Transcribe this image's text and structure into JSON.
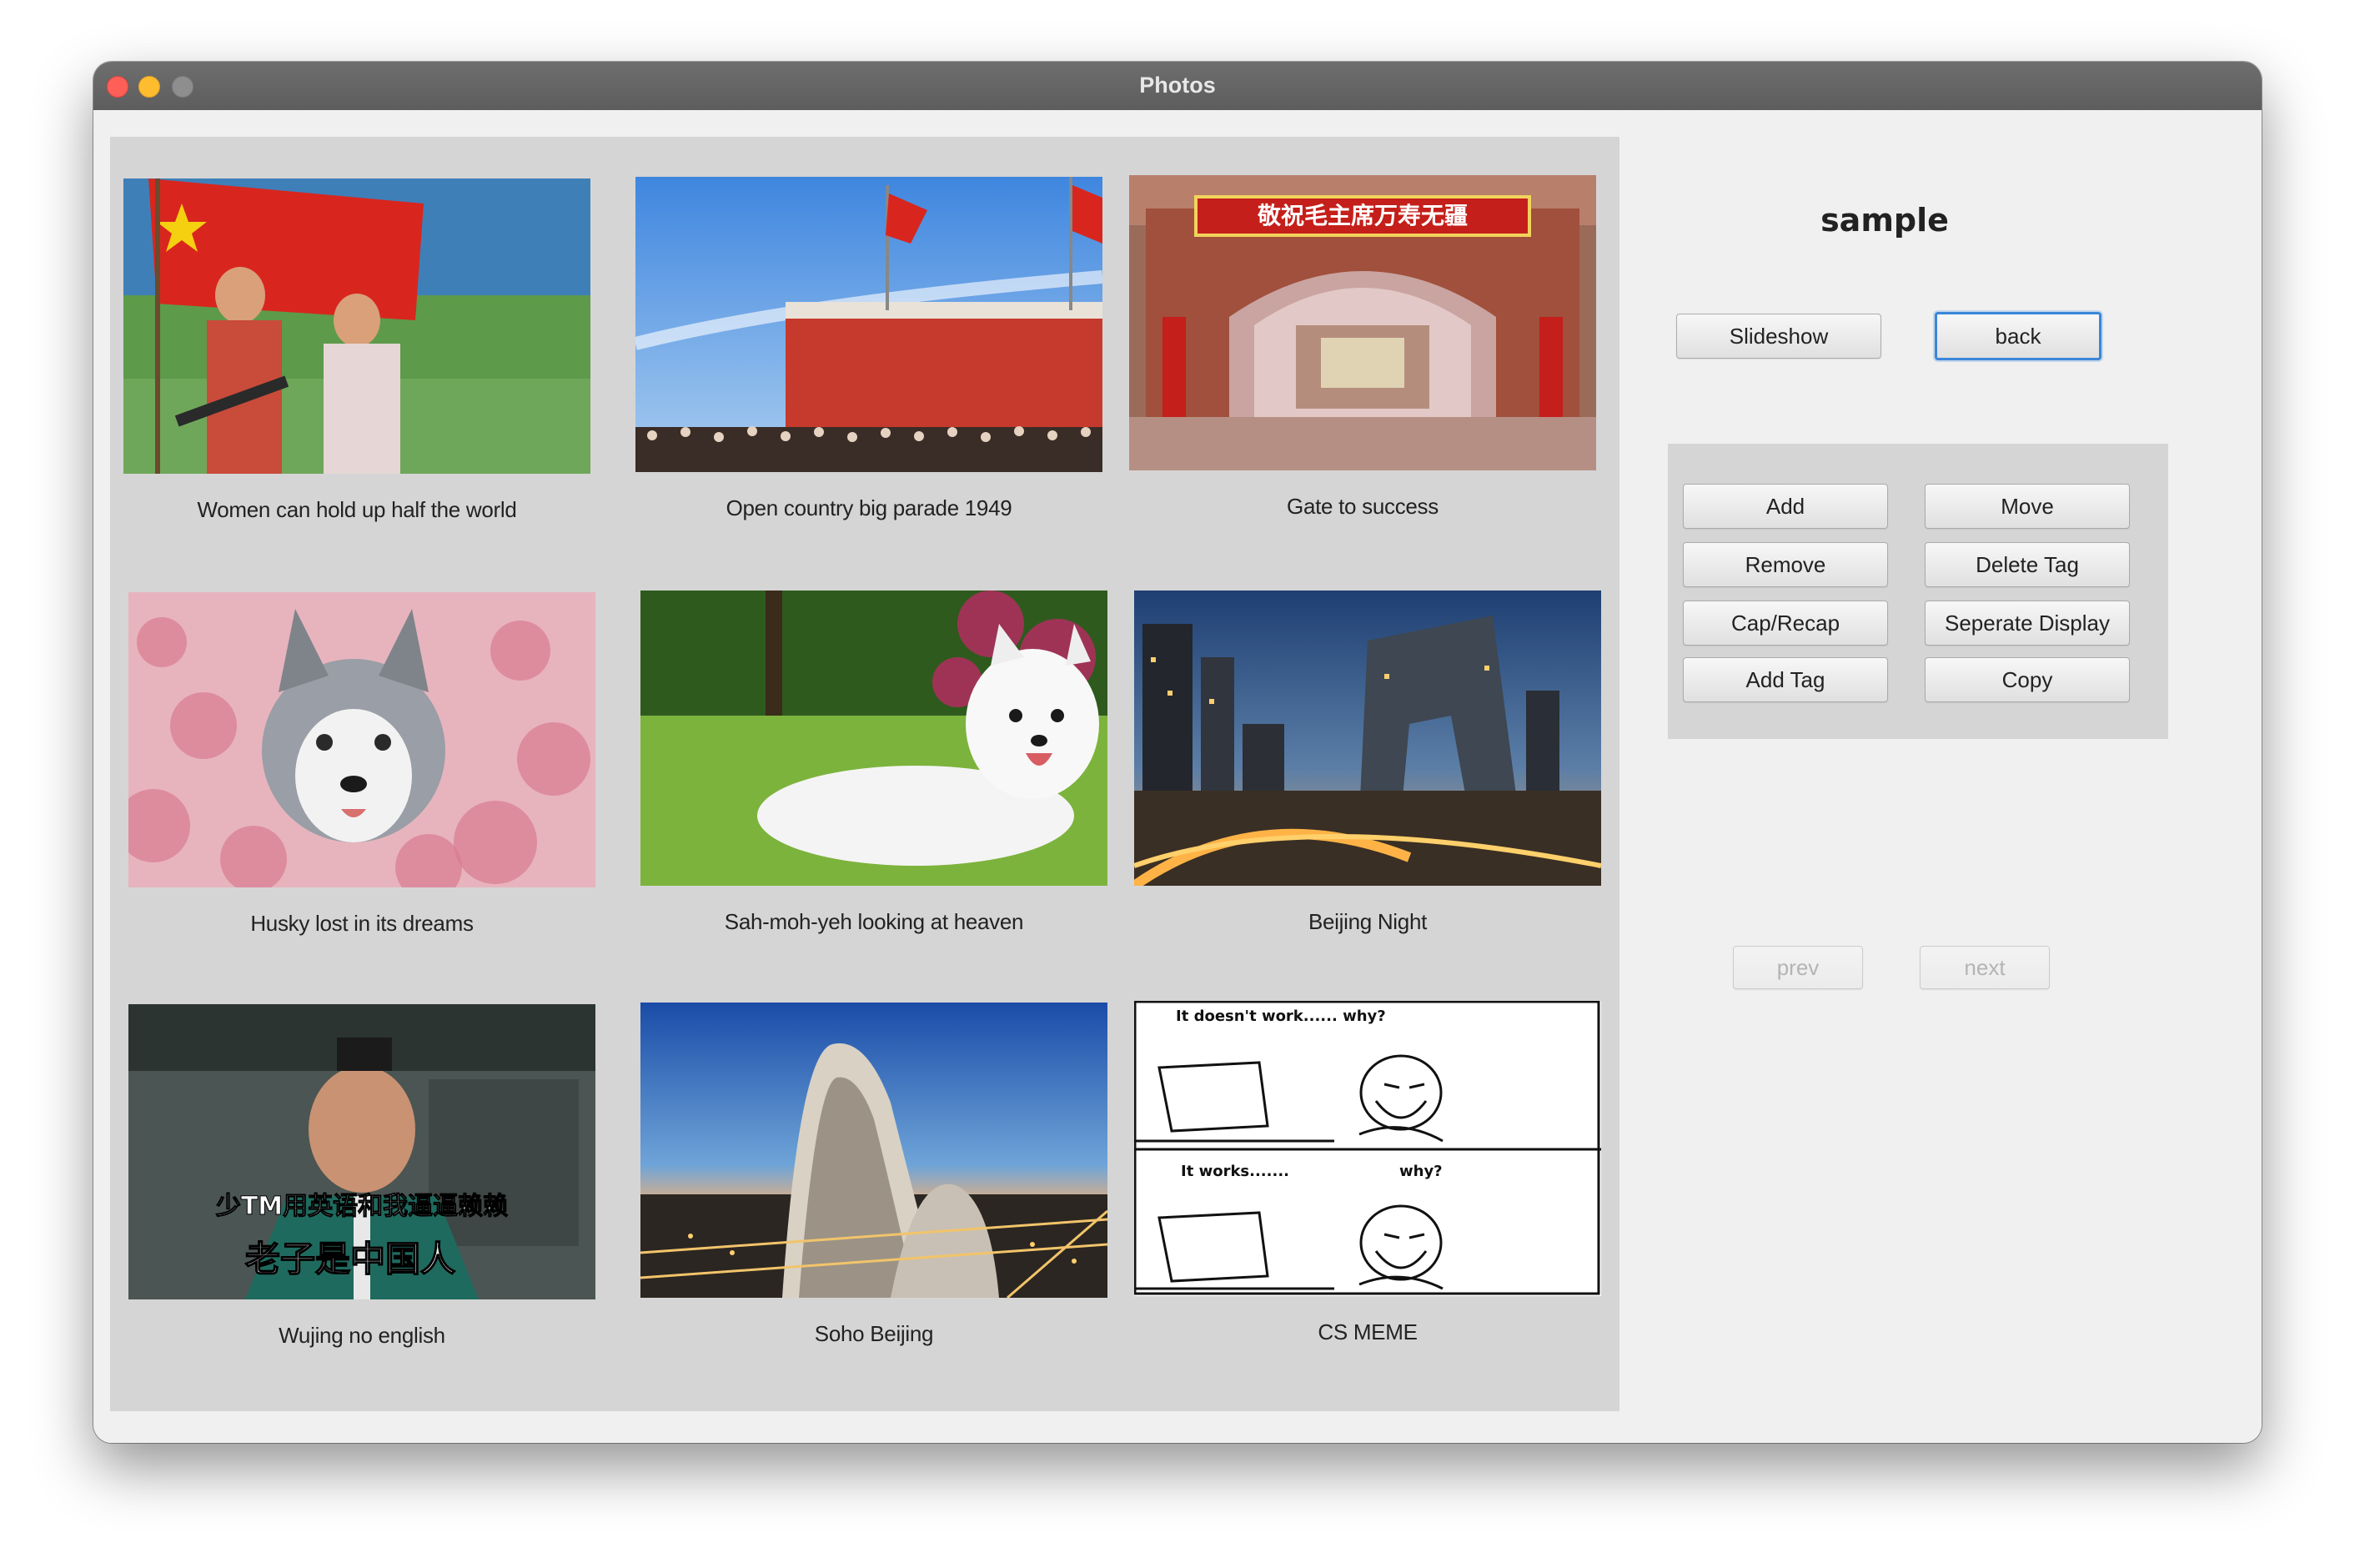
{
  "window": {
    "title": "Photos"
  },
  "album": {
    "name": "sample"
  },
  "toolbar": {
    "slideshow_label": "Slideshow",
    "back_label": "back"
  },
  "actions": {
    "add": "Add",
    "move": "Move",
    "remove": "Remove",
    "delete_tag": "Delete Tag",
    "cap_recap": "Cap/Recap",
    "separate_display": "Seperate Display",
    "add_tag": "Add Tag",
    "copy": "Copy"
  },
  "pager": {
    "prev": "prev",
    "next": "next"
  },
  "photos": [
    {
      "caption": "Women can hold up half the world",
      "icon": "propaganda-poster-photo"
    },
    {
      "caption": "Open country big parade 1949",
      "icon": "parade-photo"
    },
    {
      "caption": "Gate to success",
      "icon": "gate-photo"
    },
    {
      "caption": "Husky lost  in its dreams",
      "icon": "husky-photo"
    },
    {
      "caption": "Sah-moh-yeh looking at heaven",
      "icon": "samoyed-photo"
    },
    {
      "caption": "Beijing Night",
      "icon": "city-night-photo"
    },
    {
      "caption": "Wujing no english",
      "icon": "meme-photo"
    },
    {
      "caption": "Soho Beijing",
      "icon": "soho-building-photo"
    },
    {
      "caption": "CS MEME",
      "icon": "comic-meme-photo"
    }
  ],
  "photo_text": {
    "gate_banner": "敬祝毛主席万寿无疆",
    "meme_line1": "少TM用英语和我逼逼赖赖",
    "meme_line2": "老子是中国人",
    "comic_panel1_left": "It doesn't work...... why?",
    "comic_panel2_left": "It works.......",
    "comic_panel2_right": "why?"
  },
  "colors": {
    "titlebar": "#606060",
    "gallery_bg": "#d5d5d5",
    "focus_ring": "#3b86d8"
  }
}
